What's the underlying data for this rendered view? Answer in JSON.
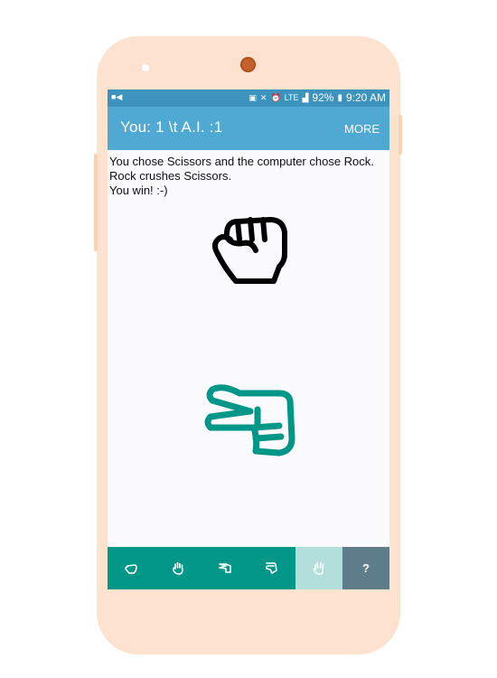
{
  "status_bar": {
    "left_icon": "video-icon",
    "icons": [
      "nfc-icon",
      "mute-icon",
      "alarm-icon"
    ],
    "network": "LTE",
    "battery": "92%",
    "time": "9:20 AM"
  },
  "app_bar": {
    "score": "You: 1 \\t A.I. :1",
    "more_label": "MORE"
  },
  "message": {
    "line1": "You chose Scissors and the computer chose Rock.",
    "line2": "Rock crushes Scissors.",
    "line3": "You win! :-)"
  },
  "computer_choice": {
    "name": "Rock",
    "icon": "fist-icon",
    "color": "#000000"
  },
  "player_choice": {
    "name": "Scissors",
    "icon": "scissors-hand-icon",
    "color": "#009688"
  },
  "bottom_bar": {
    "tabs": [
      {
        "icon": "rock-icon"
      },
      {
        "icon": "paper-icon"
      },
      {
        "icon": "scissors-icon"
      },
      {
        "icon": "lizard-icon"
      },
      {
        "icon": "spock-icon"
      },
      {
        "label": "?"
      }
    ]
  },
  "colors": {
    "status_bar": "#3c93bd",
    "app_bar": "#4fa9d3",
    "accent": "#009688",
    "selected_tab": "#b2dfdb",
    "help_tab": "#5e7d8a",
    "phone_body": "#fde3cf"
  }
}
